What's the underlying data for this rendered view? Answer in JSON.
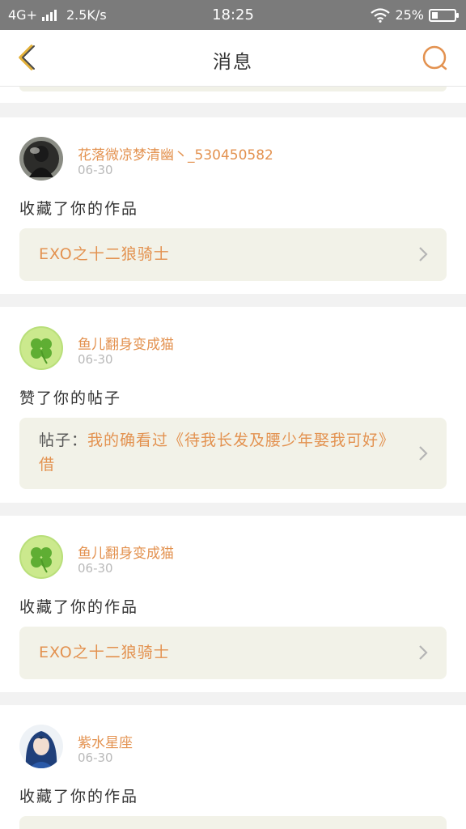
{
  "status_bar": {
    "network": "4G+",
    "speed": "2.5K/s",
    "time": "18:25",
    "battery": "25%",
    "battery_level": 0.25
  },
  "header": {
    "title": "消息",
    "back_icon": "chevron-left-icon",
    "search_icon": "search-icon"
  },
  "notifications": [
    {
      "user": "花落微凉梦清幽丶_530450582",
      "date": "06-30",
      "action": "收藏了你的作品",
      "link_label": "",
      "link_text": "EXO之十二狼骑士",
      "avatar": "dark-figure-avatar"
    },
    {
      "user": "鱼儿翻身变成猫",
      "date": "06-30",
      "action": "赞了你的帖子",
      "link_label": "帖子：",
      "link_text": "我的确看过《待我长发及腰少年娶我可好》借",
      "avatar": "clover-avatar"
    },
    {
      "user": "鱼儿翻身变成猫",
      "date": "06-30",
      "action": "收藏了你的作品",
      "link_label": "",
      "link_text": "EXO之十二狼骑士",
      "avatar": "clover-avatar"
    },
    {
      "user": "紫水星座",
      "date": "06-30",
      "action": "收藏了你的作品",
      "link_label": "",
      "link_text": "",
      "avatar": "blue-hair-girl-avatar"
    }
  ],
  "colors": {
    "accent": "#e39250",
    "status_bar": "#7b7b7b",
    "link_bg": "#f2f2e8"
  }
}
